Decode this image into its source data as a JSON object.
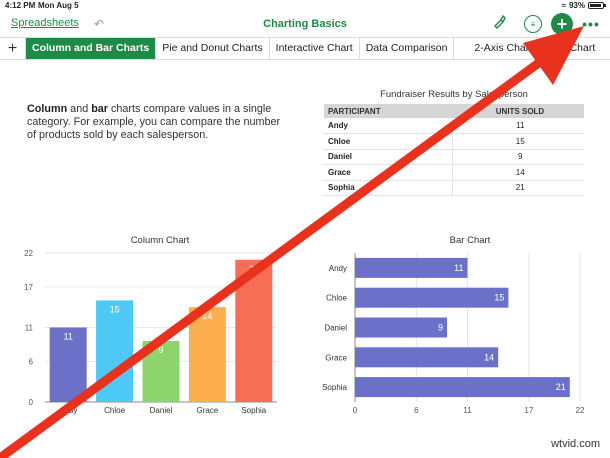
{
  "status_bar": {
    "time": "4:12 PM",
    "date": "Mon Aug 5",
    "battery": "93%"
  },
  "toolbar": {
    "back_label": "Spreadsheets",
    "title": "Charting Basics"
  },
  "icons": {
    "undo": "undo-icon",
    "brush": "paintbrush-icon",
    "filter": "filter-icon",
    "add": "add-icon",
    "more": "more-icon"
  },
  "tabs": [
    {
      "label": "Column and Bar Charts",
      "active": true
    },
    {
      "label": "Pie and Donut Charts",
      "active": false
    },
    {
      "label": "Interactive Chart",
      "active": false
    },
    {
      "label": "Data Comparison",
      "active": false
    },
    {
      "label": "2-Axis Chart",
      "active": false
    },
    {
      "label": "r Chart",
      "active": false
    }
  ],
  "intro": {
    "bold1": "Column",
    "text1": " and ",
    "bold2": "bar",
    "text2": " charts compare values in a single category. For example, you can compare the number of products sold by each salesperson."
  },
  "table": {
    "title": "Fundraiser Results by Salesperson",
    "headers": [
      "PARTICIPANT",
      "UNITS SOLD"
    ],
    "rows": [
      [
        "Andy",
        "11"
      ],
      [
        "Chloe",
        "15"
      ],
      [
        "Daniel",
        "9"
      ],
      [
        "Grace",
        "14"
      ],
      [
        "Sophia",
        "21"
      ]
    ]
  },
  "colors": {
    "accent": "#1f8a46",
    "arrow": "#e8321e",
    "bar": "#6b71c9"
  },
  "chart_data": [
    {
      "type": "bar",
      "orientation": "vertical",
      "title": "Column Chart",
      "categories": [
        "Andy",
        "Chloe",
        "Daniel",
        "Grace",
        "Sophia"
      ],
      "values": [
        11,
        15,
        9,
        14,
        21
      ],
      "colors": [
        "#6b71c9",
        "#4ec9f5",
        "#8cd46b",
        "#fdae4e",
        "#f56e55"
      ],
      "yticks": [
        0,
        6,
        11,
        17,
        22
      ],
      "ylim": [
        0,
        22
      ],
      "grid": true
    },
    {
      "type": "bar",
      "orientation": "horizontal",
      "title": "Bar Chart",
      "categories": [
        "Andy",
        "Chloe",
        "Daniel",
        "Grace",
        "Sophia"
      ],
      "values": [
        11,
        15,
        9,
        14,
        21
      ],
      "color": "#6b71c9",
      "xticks": [
        0,
        6,
        11,
        17,
        22
      ],
      "xlim": [
        0,
        22
      ],
      "grid": true
    }
  ],
  "watermark": "wtvid.com"
}
